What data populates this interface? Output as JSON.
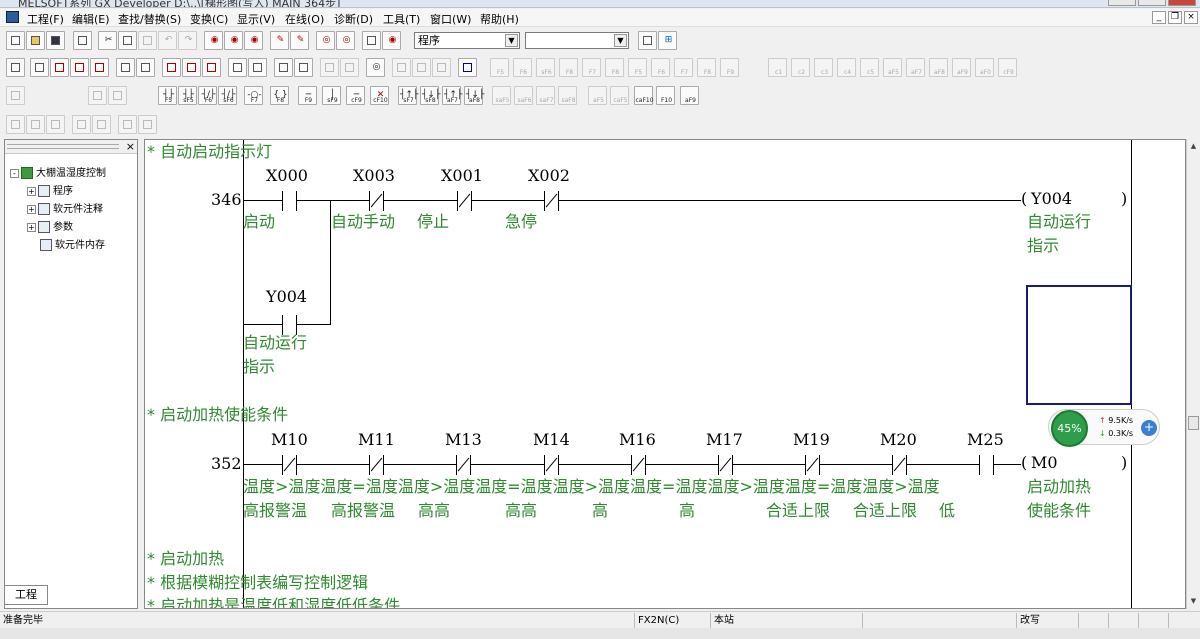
{
  "window": {
    "title": "MELSOFT系列 GX Developer D:\\..\\[梯形图(写入)  MAIN  364步]"
  },
  "menu": {
    "items": [
      "工程(F)",
      "编辑(E)",
      "查找/替换(S)",
      "变换(C)",
      "显示(V)",
      "在线(O)",
      "诊断(D)",
      "工具(T)",
      "窗口(W)",
      "帮助(H)"
    ]
  },
  "toolbar": {
    "mode_select": "程序",
    "second_select": ""
  },
  "func_keys": {
    "row2": [
      "F5",
      "F6",
      "sF6",
      "F8",
      "F7",
      "F8",
      "F5",
      "F6",
      "F7",
      "F8",
      "F9",
      "c1",
      "c2",
      "c3",
      "c4",
      "c5",
      "aF5",
      "aF7",
      "aF8",
      "aF9",
      "aF0",
      "cF9"
    ],
    "row3": [
      "F5",
      "sF5",
      "F6",
      "sF6",
      "F7",
      "F8",
      "F9",
      "sF9",
      "cF9",
      "cF10",
      "sF7",
      "sF8",
      "aF7",
      "aF8",
      "saF5",
      "saF6",
      "saF7",
      "saF8",
      "aF5",
      "caF5",
      "caF10",
      "F10",
      "aF9"
    ]
  },
  "project": {
    "tab": "工程",
    "tree": [
      {
        "label": "大棚温湿度控制",
        "level": 0,
        "expand": "-"
      },
      {
        "label": "程序",
        "level": 1,
        "expand": "+"
      },
      {
        "label": "软元件注释",
        "level": 1,
        "expand": "+"
      },
      {
        "label": "参数",
        "level": 1,
        "expand": "+"
      },
      {
        "label": "软元件内存",
        "level": 1,
        "expand": ""
      }
    ]
  },
  "ladder": {
    "comment1": "* 自动启动指示灯",
    "rung1": {
      "step": "346",
      "contacts": [
        {
          "dev": "X000",
          "type": "NO",
          "comment": "启动"
        },
        {
          "dev": "X003",
          "type": "NC",
          "comment": "自动手动"
        },
        {
          "dev": "X001",
          "type": "NC",
          "comment": "停止"
        },
        {
          "dev": "X002",
          "type": "NC",
          "comment": "急停"
        }
      ],
      "coil": {
        "dev": "Y004",
        "comment1": "自动运行",
        "comment2": "指示"
      },
      "branch": {
        "dev": "Y004",
        "type": "NO",
        "comment1": "自动运行",
        "comment2": "指示"
      }
    },
    "comment2": "* 启动加热使能条件",
    "rung2": {
      "step": "352",
      "contacts": [
        {
          "dev": "M10",
          "type": "NC",
          "comment1": "温度>温",
          "comment2": "高报警温"
        },
        {
          "dev": "M11",
          "type": "NC",
          "comment1": "度温度=",
          "comment2": "高报警温"
        },
        {
          "dev": "M13",
          "type": "NC",
          "comment1": "温度温度>",
          "comment2": "高高"
        },
        {
          "dev": "M14",
          "type": "NC",
          "comment1": "温度温度=",
          "comment2": "高高"
        },
        {
          "dev": "M16",
          "type": "NC",
          "comment1": "温度温度>",
          "comment2": "高"
        },
        {
          "dev": "M17",
          "type": "NC",
          "comment1": "温度温度=",
          "comment2": "高"
        },
        {
          "dev": "M19",
          "type": "NC",
          "comment1": "温度温度>",
          "comment2": "合适上限"
        },
        {
          "dev": "M20",
          "type": "NC",
          "comment1": "温度温度=",
          "comment2": "合适上限"
        },
        {
          "dev": "M25",
          "type": "NO",
          "comment1": "温度温度>",
          "comment2": "低"
        }
      ],
      "coil": {
        "dev": "M0",
        "comment1": "启动加热",
        "comment2": "使能条件"
      }
    },
    "rung2_comment_row1": "温度>温度温度=温度温度>温度温度=温度温度>温度温度=温度温度>温度温度=温度温度>温度",
    "comment3": "* 启动加热",
    "comment4": "* 根据模糊控制表编写控制逻辑",
    "comment5": "* 启动加热是温度低和湿度低低条件"
  },
  "status": {
    "ready": "准备完毕",
    "plc": "FX2N(C)",
    "station": "本站",
    "mode": "改写"
  },
  "net_widget": {
    "percent": "45%",
    "up": "9.5K/s",
    "down": "0.3K/s"
  }
}
